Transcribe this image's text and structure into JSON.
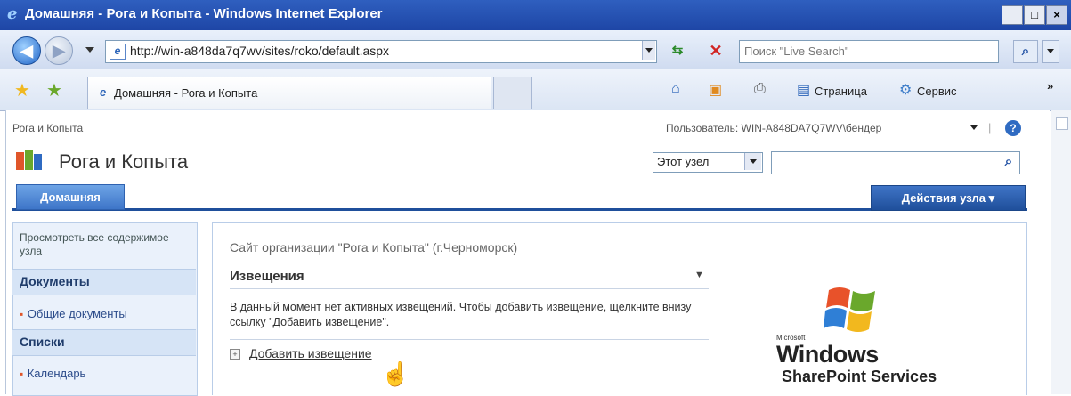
{
  "window": {
    "title": "Домашняя - Рога и Копыта - Windows Internet Explorer",
    "controls": {
      "minimize": "_",
      "maximize": "□",
      "close": "×"
    }
  },
  "address_bar": {
    "url": "http://win-a848da7q7wv/sites/roko/default.aspx",
    "search_placeholder": "Поиск \"Live Search\""
  },
  "tabs": [
    {
      "label": "Домашняя - Рога и Копыта"
    }
  ],
  "command_bar": {
    "page_label": "Страница",
    "tools_label": "Сервис"
  },
  "sharepoint": {
    "breadcrumb": "Рога и Копыта",
    "user_label": "Пользователь: WIN-A848DA7Q7WV\\бендер",
    "site_title": "Рога и Копыта",
    "search_scope": "Этот узел",
    "top_nav": {
      "home_tab": "Домашняя",
      "site_actions": "Действия узла"
    },
    "quick_launch": {
      "view_all": "Просмотреть все содержимое узла",
      "documents_heading": "Документы",
      "documents_items": [
        "Общие документы"
      ],
      "lists_heading": "Списки",
      "lists_items": [
        "Календарь"
      ]
    },
    "main": {
      "site_description": "Сайт организации \"Рога и Копыта\" (г.Черноморск)",
      "webpart_title": "Извещения",
      "webpart_body": "В данный момент нет активных извещений. Чтобы добавить извещение, щелкните внизу ссылку \"Добавить извещение\".",
      "add_link": "Добавить извещение"
    },
    "logo": {
      "microsoft": "Microsoft",
      "windows": "Windows",
      "product": "SharePoint Services"
    }
  },
  "colors": {
    "titlebar": "#1e46a6",
    "nav_blue": "#1f4f9b",
    "bullet": "#e0562a"
  }
}
